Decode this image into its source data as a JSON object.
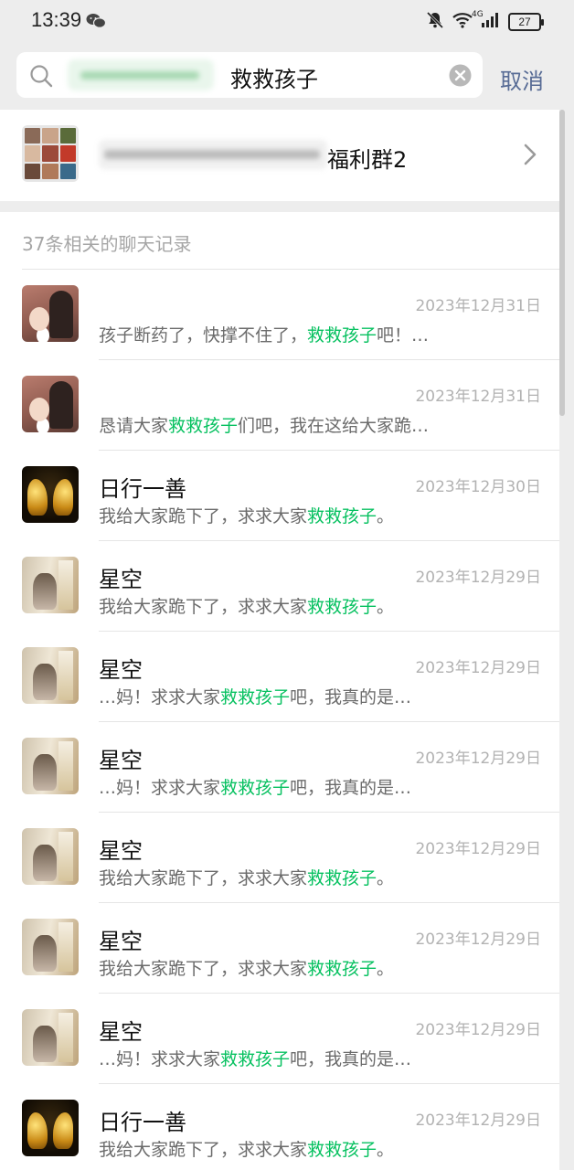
{
  "status_bar": {
    "time": "13:39",
    "battery": "27",
    "network": "4G",
    "icons": [
      "wechat-icon",
      "mute-bell-icon",
      "wifi-icon",
      "signal-icon",
      "battery-icon"
    ]
  },
  "search": {
    "query": "救救孩子",
    "cancel_label": "取消"
  },
  "group": {
    "name_suffix": "福利群2"
  },
  "results": {
    "header": "37条相关的聊天记录",
    "highlight_color": "#07c160",
    "items": [
      {
        "avatar": "girl",
        "name": "",
        "date": "2023年12月31日",
        "pre": "孩子断药了，快撑不住了，",
        "hl": "救救孩子",
        "post": "吧！…"
      },
      {
        "avatar": "girl",
        "name": "",
        "date": "2023年12月31日",
        "pre": "恳请大家",
        "hl": "救救孩子",
        "post": "们吧，我在这给大家跪…"
      },
      {
        "avatar": "dragon",
        "name": "日行一善",
        "date": "2023年12月30日",
        "pre": "我给大家跪下了，求求大家",
        "hl": "救救孩子",
        "post": "。"
      },
      {
        "avatar": "sky",
        "name": "星空",
        "date": "2023年12月29日",
        "pre": "我给大家跪下了，求求大家",
        "hl": "救救孩子",
        "post": "。"
      },
      {
        "avatar": "sky",
        "name": "星空",
        "date": "2023年12月29日",
        "pre": "…妈！求求大家",
        "hl": "救救孩子",
        "post": "吧，我真的是…"
      },
      {
        "avatar": "sky",
        "name": "星空",
        "date": "2023年12月29日",
        "pre": "…妈！求求大家",
        "hl": "救救孩子",
        "post": "吧，我真的是…"
      },
      {
        "avatar": "sky",
        "name": "星空",
        "date": "2023年12月29日",
        "pre": "我给大家跪下了，求求大家",
        "hl": "救救孩子",
        "post": "。"
      },
      {
        "avatar": "sky",
        "name": "星空",
        "date": "2023年12月29日",
        "pre": "我给大家跪下了，求求大家",
        "hl": "救救孩子",
        "post": "。"
      },
      {
        "avatar": "sky",
        "name": "星空",
        "date": "2023年12月29日",
        "pre": "…妈！求求大家",
        "hl": "救救孩子",
        "post": "吧，我真的是…"
      },
      {
        "avatar": "dragon",
        "name": "日行一善",
        "date": "2023年12月29日",
        "pre": "我给大家跪下了，求求大家",
        "hl": "救救孩子",
        "post": "。"
      }
    ]
  }
}
